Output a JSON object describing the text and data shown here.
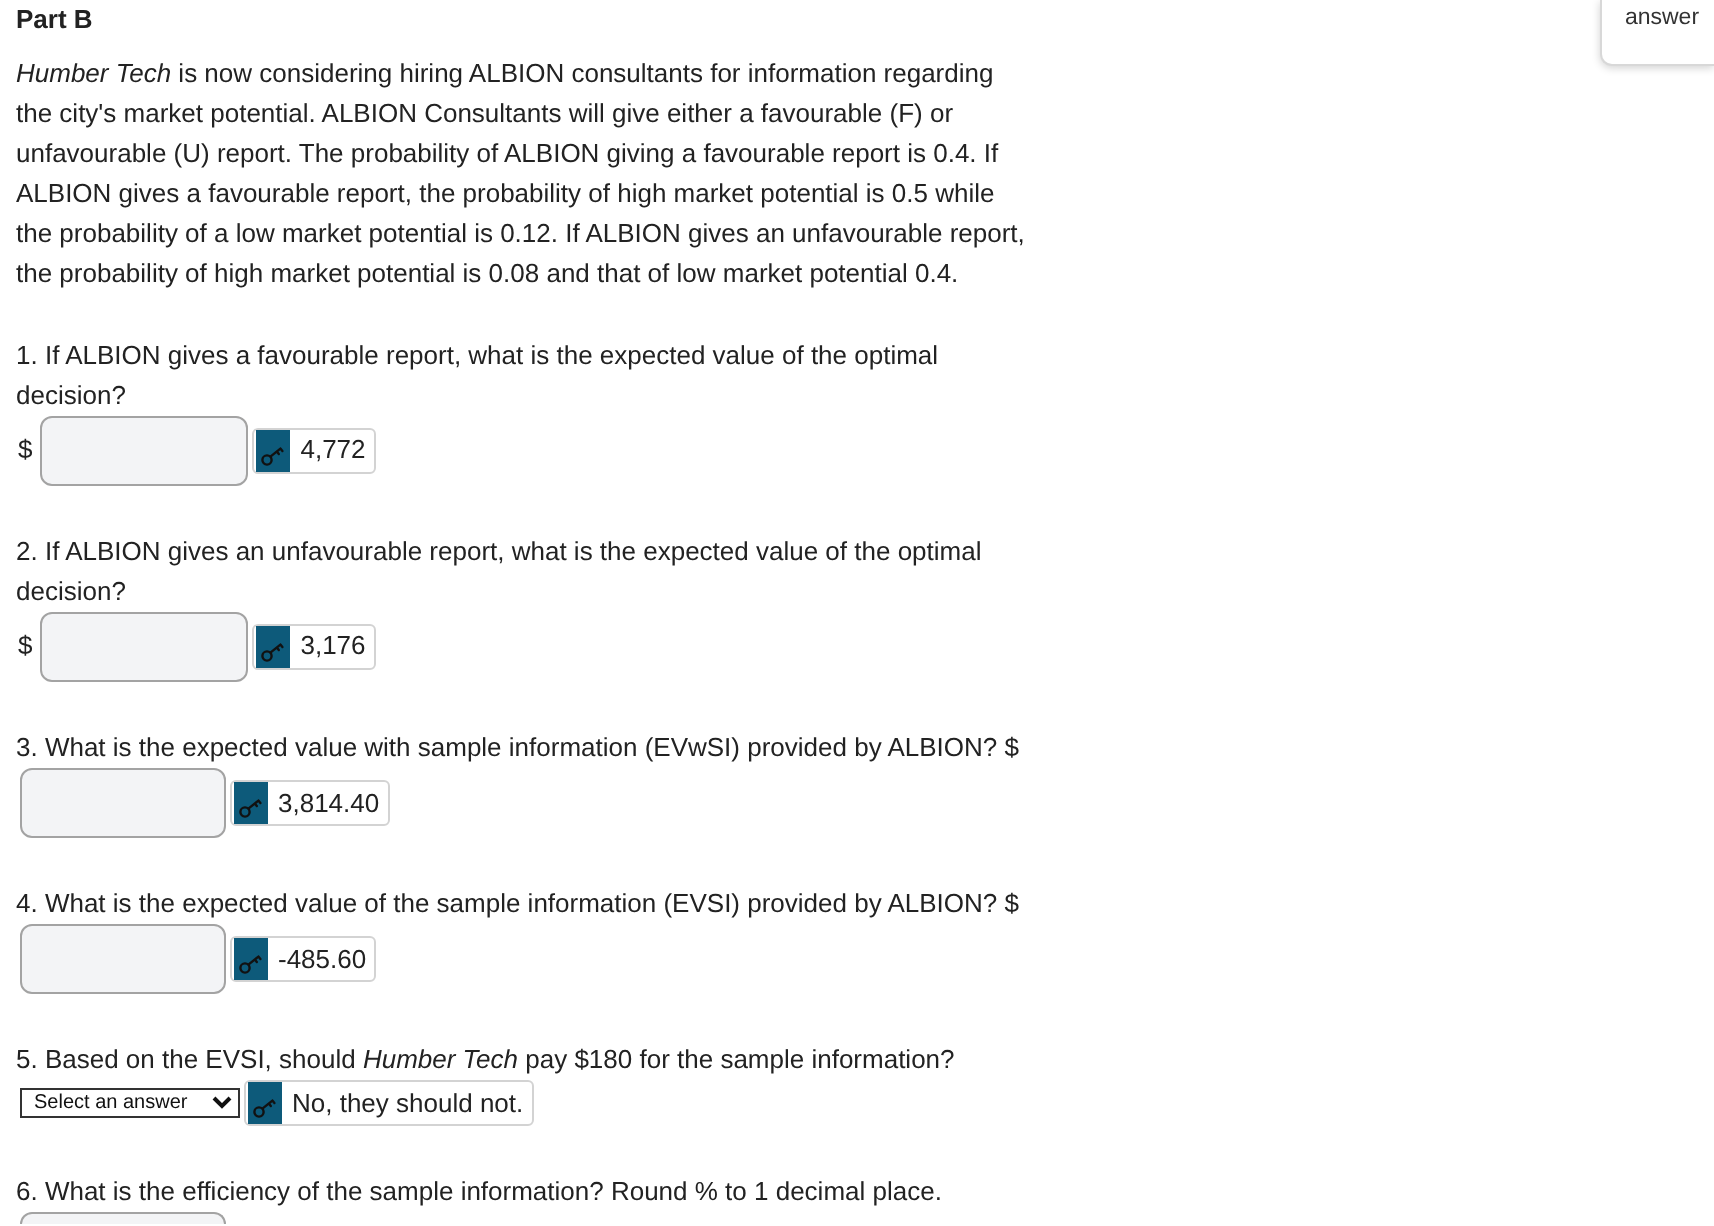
{
  "answer_button": {
    "label": "answer"
  },
  "part": {
    "title": "Part B",
    "intro": "*Humber Tech* is now considering hiring ALBION consultants for information regarding the city's market potential. ALBION Consultants will give either a favourable (F) or unfavourable (U) report. The probability of ALBION giving a favourable report is 0.4. If ALBION gives a favourable report, the probability of high market potential is 0.5 while the probability of a low market potential is 0.12. If ALBION gives an unfavourable report, the probability of high market potential is 0.08 and that of low market potential 0.4."
  },
  "questions": [
    {
      "kind": "number",
      "prompt": "1. If ALBION gives a favourable report, what is the expected value of the optimal decision?",
      "prefix": "$",
      "answer": "4,772"
    },
    {
      "kind": "number",
      "prompt": "2. If ALBION gives an unfavourable report, what is the expected value of the optimal decision?",
      "prefix": "$",
      "answer": "3,176"
    },
    {
      "kind": "number",
      "prompt": "3. What is the expected value with sample information (EVwSI) provided by ALBION? $",
      "answer": "3,814.40"
    },
    {
      "kind": "number",
      "prompt": "4. What is the expected value of the sample information (EVSI) provided by ALBION? $",
      "answer": "-485.60"
    },
    {
      "kind": "select",
      "prompt": "5. Based on the EVSI, should *Humber Tech* pay $180 for the sample information?",
      "value": "Select an answer",
      "answer": "No, they should not."
    },
    {
      "kind": "number",
      "prompt": "6. What is the efficiency of the sample information? Round % to 1 decimal place."
    }
  ]
}
